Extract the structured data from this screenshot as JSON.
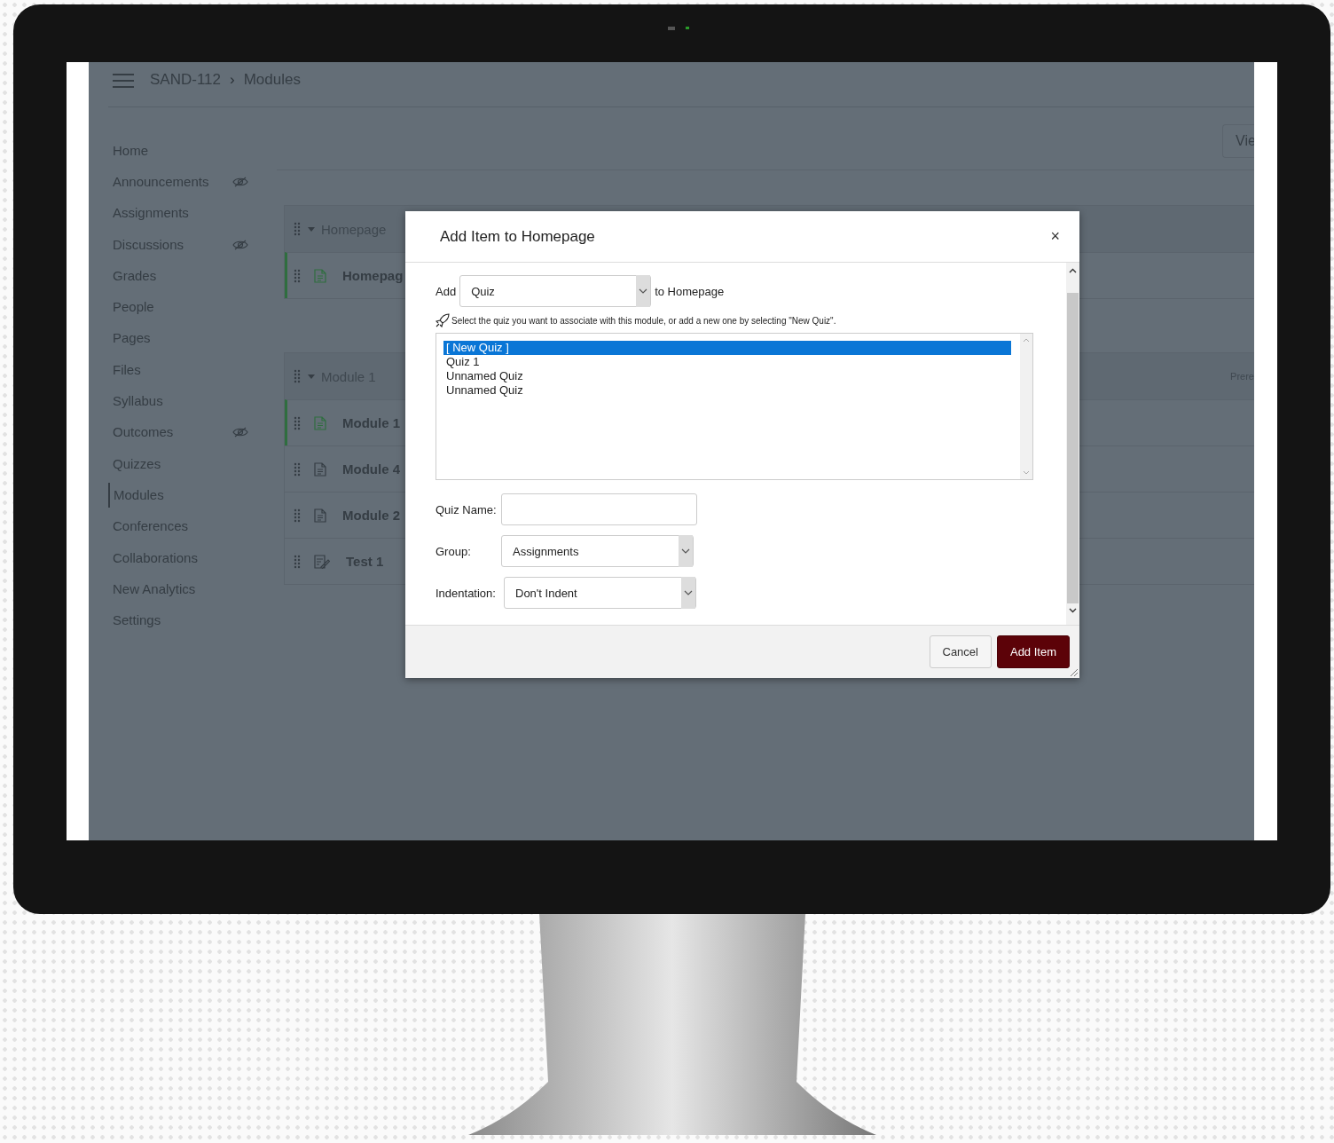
{
  "breadcrumb": {
    "course": "SAND-112",
    "separator": "›",
    "page": "Modules"
  },
  "sidebar": {
    "items": [
      {
        "label": "Home",
        "selected": false,
        "hidden": false
      },
      {
        "label": "Announcements",
        "selected": false,
        "hidden": true
      },
      {
        "label": "Assignments",
        "selected": false,
        "hidden": false
      },
      {
        "label": "Discussions",
        "selected": false,
        "hidden": true
      },
      {
        "label": "Grades",
        "selected": false,
        "hidden": false
      },
      {
        "label": "People",
        "selected": false,
        "hidden": false
      },
      {
        "label": "Pages",
        "selected": false,
        "hidden": false
      },
      {
        "label": "Files",
        "selected": false,
        "hidden": false
      },
      {
        "label": "Syllabus",
        "selected": false,
        "hidden": false
      },
      {
        "label": "Outcomes",
        "selected": false,
        "hidden": true
      },
      {
        "label": "Quizzes",
        "selected": false,
        "hidden": false
      },
      {
        "label": "Modules",
        "selected": true,
        "hidden": false
      },
      {
        "label": "Conferences",
        "selected": false,
        "hidden": false
      },
      {
        "label": "Collaborations",
        "selected": false,
        "hidden": false
      },
      {
        "label": "New Analytics",
        "selected": false,
        "hidden": false
      },
      {
        "label": "Settings",
        "selected": false,
        "hidden": false
      }
    ]
  },
  "toolbar": {
    "button": "Vie"
  },
  "modules": [
    {
      "title": "Homepage",
      "expanded": true,
      "items": [
        {
          "title": "Homepag",
          "kind": "page",
          "published": true
        }
      ]
    },
    {
      "title": "Module 1",
      "expanded": true,
      "extra": "Prere",
      "items": [
        {
          "title": "Module 1",
          "kind": "page",
          "published": true
        },
        {
          "title": "Module 4",
          "kind": "page",
          "published": false
        },
        {
          "title": "Module 2",
          "kind": "page",
          "published": false
        },
        {
          "title": "Test 1",
          "kind": "quiz",
          "published": false
        }
      ]
    }
  ],
  "dialog": {
    "title": "Add Item to Homepage",
    "close": "×",
    "add_label": "Add",
    "type_select": "Quiz",
    "target_text": "to Homepage",
    "hint": "Select the quiz you want to associate with this module, or add a new one by selecting \"New Quiz\".",
    "options": [
      {
        "label": "[ New Quiz ]",
        "selected": true
      },
      {
        "label": "Quiz 1",
        "selected": false
      },
      {
        "label": "Unnamed Quiz",
        "selected": false
      },
      {
        "label": "Unnamed Quiz",
        "selected": false
      }
    ],
    "fields": [
      {
        "label": "Quiz Name:",
        "kind": "text"
      },
      {
        "label": "Group:",
        "kind": "select",
        "value": "Assignments"
      },
      {
        "label": "Indentation:",
        "kind": "select",
        "value": "Don't Indent"
      }
    ],
    "buttons": [
      {
        "label": "Cancel",
        "kind": "secondary"
      },
      {
        "label": "Add Item",
        "kind": "primary"
      }
    ]
  }
}
